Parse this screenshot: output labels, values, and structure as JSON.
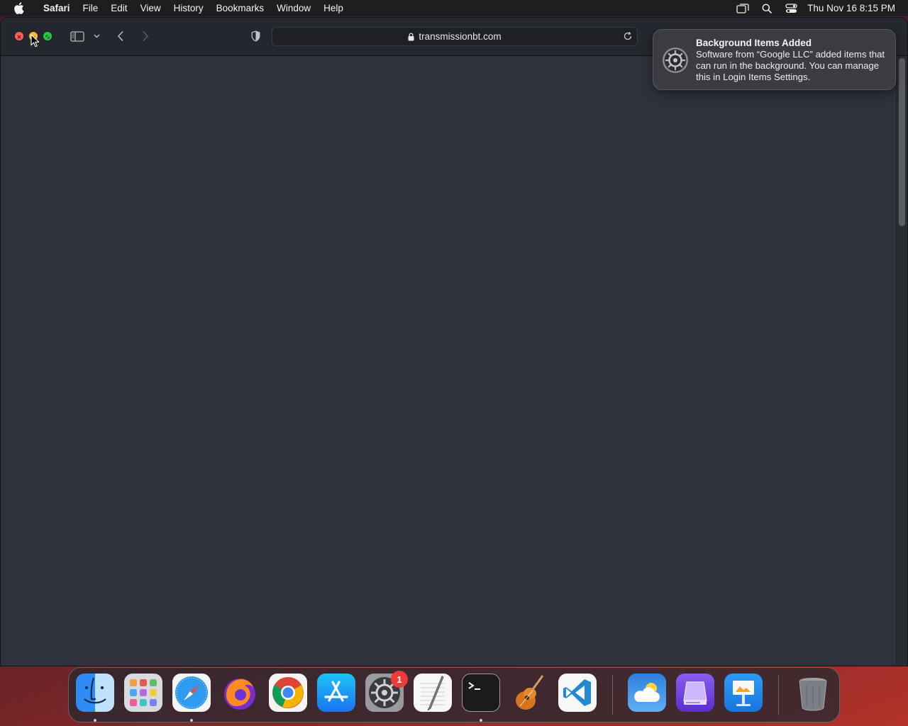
{
  "menubar": {
    "app_name": "Safari",
    "items": [
      "File",
      "Edit",
      "View",
      "History",
      "Bookmarks",
      "Window",
      "Help"
    ],
    "status_icons": [
      "display-icon",
      "search-icon",
      "control-center-icon"
    ],
    "clock": "Thu Nov 16  8:15 PM"
  },
  "window": {
    "url": "transmissionbt.com",
    "toolbar_icons": [
      "sidebar-icon",
      "chevron-down-icon",
      "back-icon",
      "forward-icon",
      "privacy-shield-icon",
      "lock-icon",
      "reload-icon"
    ]
  },
  "notification": {
    "title": "Background Items Added",
    "body": "Software from “Google LLC” added items that can run in the background. You can manage this in Login Items Settings.",
    "icon": "system-settings-icon"
  },
  "dock": {
    "apps": [
      {
        "name": "Finder",
        "icon": "finder-icon",
        "running": true
      },
      {
        "name": "Launchpad",
        "icon": "launchpad-icon",
        "running": false
      },
      {
        "name": "Safari",
        "icon": "safari-icon",
        "running": true
      },
      {
        "name": "Firefox",
        "icon": "firefox-icon",
        "running": false
      },
      {
        "name": "Google Chrome",
        "icon": "chrome-icon",
        "running": false
      },
      {
        "name": "App Store",
        "icon": "app-store-icon",
        "running": false
      },
      {
        "name": "System Settings",
        "icon": "system-settings-icon",
        "running": false,
        "badge": "1"
      },
      {
        "name": "TextEdit",
        "icon": "textedit-icon",
        "running": false
      },
      {
        "name": "Terminal",
        "icon": "terminal-icon",
        "running": true
      },
      {
        "name": "GarageBand",
        "icon": "garageband-icon",
        "running": false
      },
      {
        "name": "Visual Studio Code",
        "icon": "vscode-icon",
        "running": false
      },
      {
        "name": "Weather",
        "icon": "weather-icon",
        "running": false
      },
      {
        "name": "Storage Drive",
        "icon": "drive-icon",
        "running": false
      },
      {
        "name": "Keynote",
        "icon": "keynote-icon",
        "running": false
      },
      {
        "name": "Trash",
        "icon": "trash-icon",
        "running": false
      }
    ]
  },
  "colors": {
    "menubar_bg": "#1e1e21",
    "window_bg": "#2f323c",
    "toolbar_bg": "#25272e",
    "close": "#fe5f57",
    "minimize": "#febc2e",
    "zoom": "#28c840",
    "badge": "#f03a3a"
  }
}
